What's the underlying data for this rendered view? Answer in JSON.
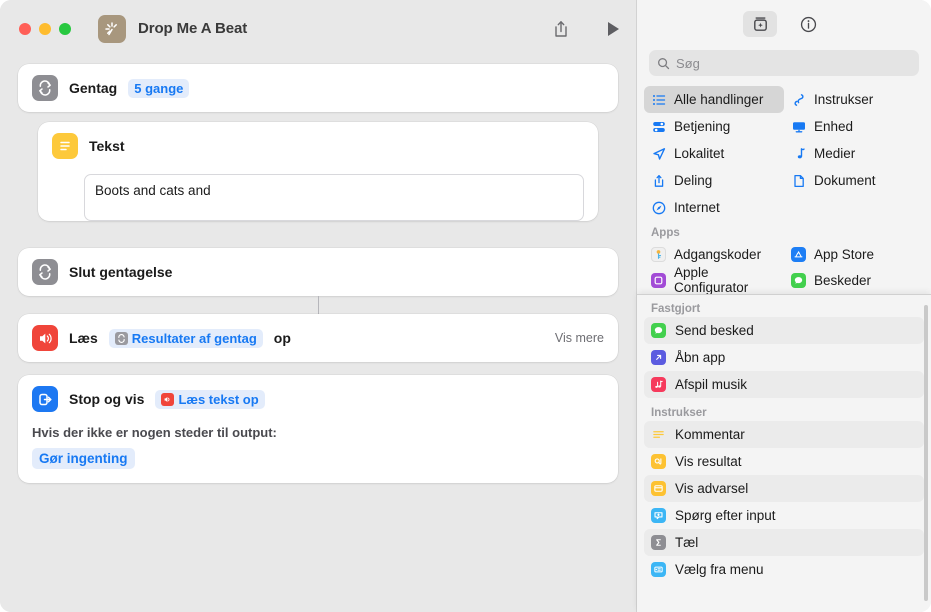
{
  "window": {
    "title": "Drop Me A Beat",
    "app_icon": "shortcuts-icon",
    "traffic_lights": {
      "close": "close-button",
      "minimize": "minimize-button",
      "zoom": "zoom-button"
    },
    "toolbar": {
      "share_label": "share-icon",
      "run_label": "run-icon"
    }
  },
  "workflow": {
    "actions": [
      {
        "id": "repeat",
        "title": "Gentag",
        "token": "5 gange",
        "icon": "repeat-icon"
      },
      {
        "id": "text",
        "title": "Tekst",
        "value": "Boots and cats and",
        "icon": "text-icon"
      },
      {
        "id": "end-repeat",
        "title": "Slut gentagelse",
        "icon": "repeat-icon"
      },
      {
        "id": "speak",
        "title_prefix": "Læs",
        "token": "Resultater af gentag",
        "title_suffix": "op",
        "show_more": "Vis mere",
        "icon": "speaker-icon"
      },
      {
        "id": "stop-and-output",
        "title": "Stop og vis",
        "token": "Læs tekst op",
        "subtitle": "Hvis der ikke er nogen steder til output:",
        "option": "Gør ingenting",
        "icon": "stop-output-icon"
      }
    ]
  },
  "inspector": {
    "tabs": [
      {
        "name": "actions-library-tab",
        "icon": "action-library-icon",
        "active": true
      },
      {
        "name": "info-tab",
        "icon": "info-circle-icon",
        "active": false
      }
    ],
    "search": {
      "placeholder": "Søg",
      "value": "",
      "icon": "search-icon"
    },
    "categories": [
      {
        "label": "Alle handlinger",
        "icon": "list-bullet-icon",
        "selected": true
      },
      {
        "label": "Instrukser",
        "icon": "scripting-icon",
        "selected": false
      },
      {
        "label": "Betjening",
        "icon": "controls-icon",
        "selected": false
      },
      {
        "label": "Enhed",
        "icon": "display-icon",
        "selected": false
      },
      {
        "label": "Lokalitet",
        "icon": "location-arrow-icon",
        "selected": false
      },
      {
        "label": "Medier",
        "icon": "music-note-icon",
        "selected": false
      },
      {
        "label": "Deling",
        "icon": "share-icon",
        "selected": false
      },
      {
        "label": "Dokument",
        "icon": "document-icon",
        "selected": false
      },
      {
        "label": "Internet",
        "icon": "safari-compass-icon",
        "selected": false
      }
    ],
    "apps_section_label": "Apps",
    "apps": [
      {
        "label": "Adgangskoder",
        "icon": "passwords-icon",
        "color": "#f2f2f2"
      },
      {
        "label": "App Store",
        "icon": "appstore-icon",
        "color": "#1d7ef5"
      },
      {
        "label": "Apple Configurator",
        "icon": "configurator-icon",
        "color": "#a24bd6"
      },
      {
        "label": "Beskeder",
        "icon": "messages-icon",
        "color": "#43d04e"
      }
    ]
  },
  "popover": {
    "pinned_label": "Fastgjort",
    "pinned": [
      {
        "label": "Send besked",
        "icon": "messages-icon",
        "color": "#43d04e"
      },
      {
        "label": "Åbn app",
        "icon": "open-app-icon",
        "color": "#5c5ce0"
      },
      {
        "label": "Afspil musik",
        "icon": "music-icon",
        "color": "#f63a5c"
      }
    ],
    "scripting_label": "Instrukser",
    "scripting": [
      {
        "label": "Kommentar",
        "icon": "comment-icon",
        "color": "#fdc93b"
      },
      {
        "label": "Vis resultat",
        "icon": "quicklook-icon",
        "color": "#fdc232"
      },
      {
        "label": "Vis advarsel",
        "icon": "alert-icon",
        "color": "#fdc232"
      },
      {
        "label": "Spørg efter input",
        "icon": "ask-input-icon",
        "color": "#3cb6f5"
      },
      {
        "label": "Tæl",
        "icon": "count-icon",
        "color": "#8e8e93"
      },
      {
        "label": "Vælg fra menu",
        "icon": "choose-menu-icon",
        "color": "#3cb6f5"
      }
    ]
  },
  "colors": {
    "accent": "#1779f3",
    "token_bg": "#e3ecfb",
    "grey_icon": "#8e8e93",
    "red_icon": "#f0453a",
    "yellow_icon": "#fdc93b",
    "blue_icon": "#1d78f2"
  }
}
